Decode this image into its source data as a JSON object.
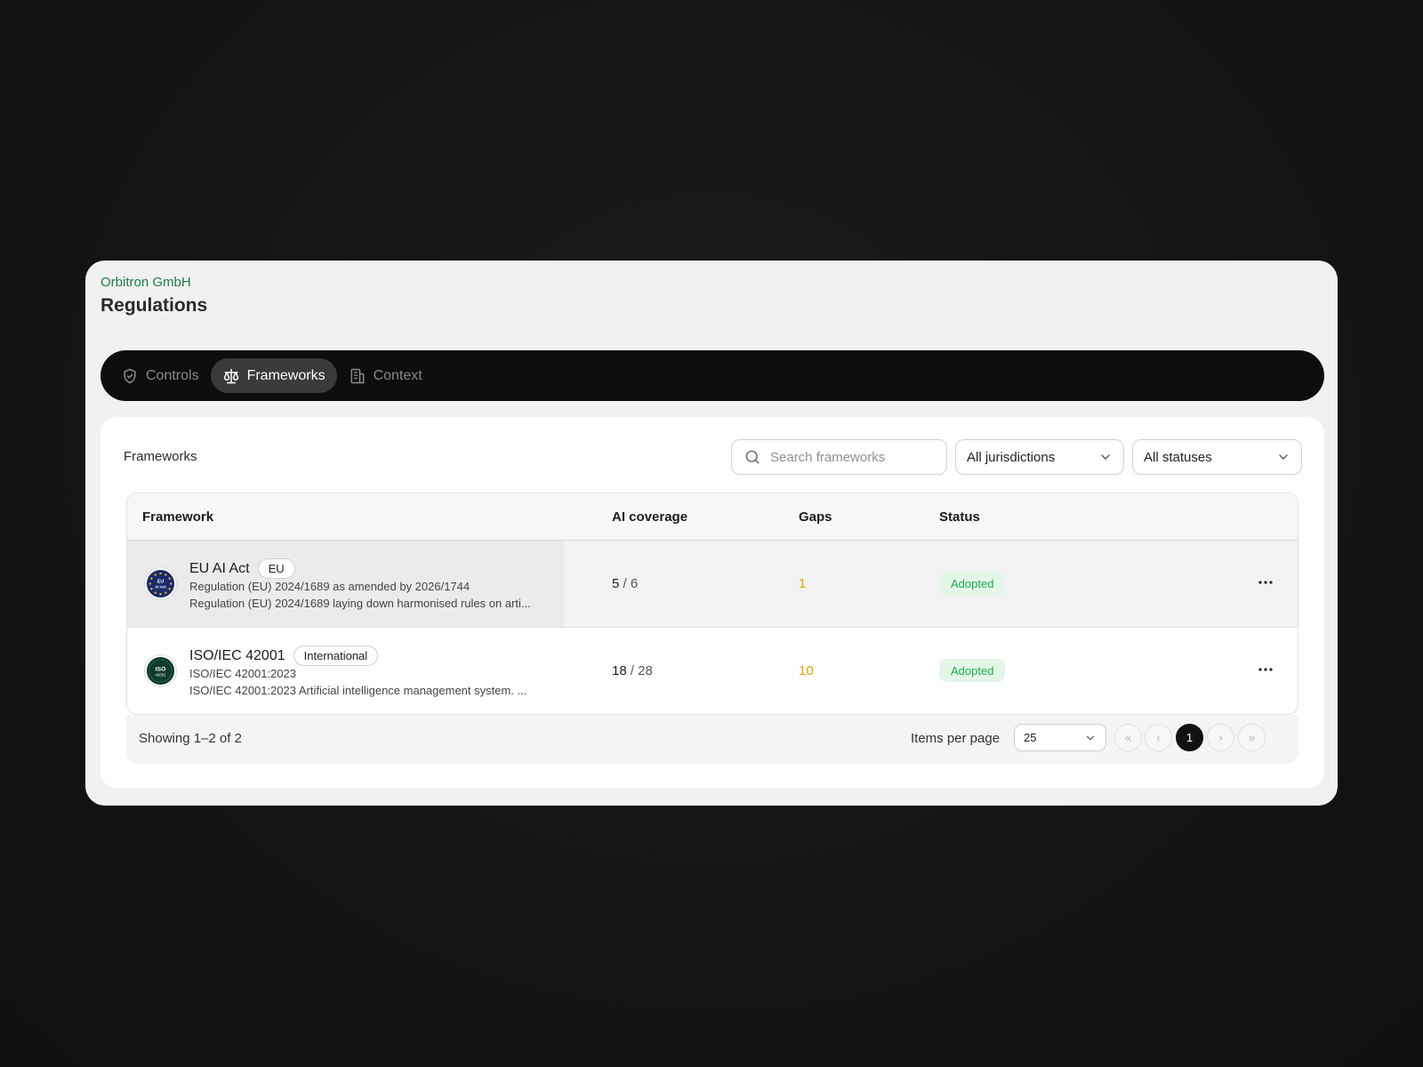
{
  "header": {
    "org": "Orbitron GmbH",
    "title": "Regulations"
  },
  "tabs": [
    {
      "label": "Controls",
      "icon": "shield-check-icon",
      "active": false
    },
    {
      "label": "Frameworks",
      "icon": "scale-icon",
      "active": true
    },
    {
      "label": "Context",
      "icon": "building-icon",
      "active": false
    }
  ],
  "panel": {
    "title": "Frameworks",
    "search_placeholder": "Search frameworks",
    "jurisdiction_filter": "All jurisdictions",
    "status_filter": "All statuses"
  },
  "table": {
    "columns": [
      "Framework",
      "AI coverage",
      "Gaps",
      "Status"
    ],
    "rows": [
      {
        "logo_text": [
          "EU",
          "AI Act"
        ],
        "name": "EU AI Act",
        "badge": "EU",
        "subtitle": "Regulation (EU) 2024/1689 as amended by 2026/1744",
        "description": "Regulation (EU) 2024/1689 laying down harmonised rules on arti...",
        "coverage_done": "5",
        "coverage_total": "/ 6",
        "gaps": "1",
        "status": "Adopted"
      },
      {
        "logo_text": [
          "ISO",
          "42001"
        ],
        "name": "ISO/IEC 42001",
        "badge": "International",
        "subtitle": "ISO/IEC 42001:2023",
        "description": "ISO/IEC 42001:2023 Artificial intelligence management system. ...",
        "coverage_done": "18",
        "coverage_total": "/ 28",
        "gaps": "10",
        "status": "Adopted"
      }
    ]
  },
  "footer": {
    "showing": "Showing 1–2 of 2",
    "items_per_page_label": "Items per page",
    "items_per_page": "25",
    "pagination": {
      "first": "«",
      "prev": "‹",
      "current": "1",
      "next": "›",
      "last": "»"
    }
  },
  "colors": {
    "brand_green": "#1f7a45",
    "gaps_amber": "#e3a400",
    "status_green": "#21a84f",
    "status_bg": "#e3f6e8"
  }
}
